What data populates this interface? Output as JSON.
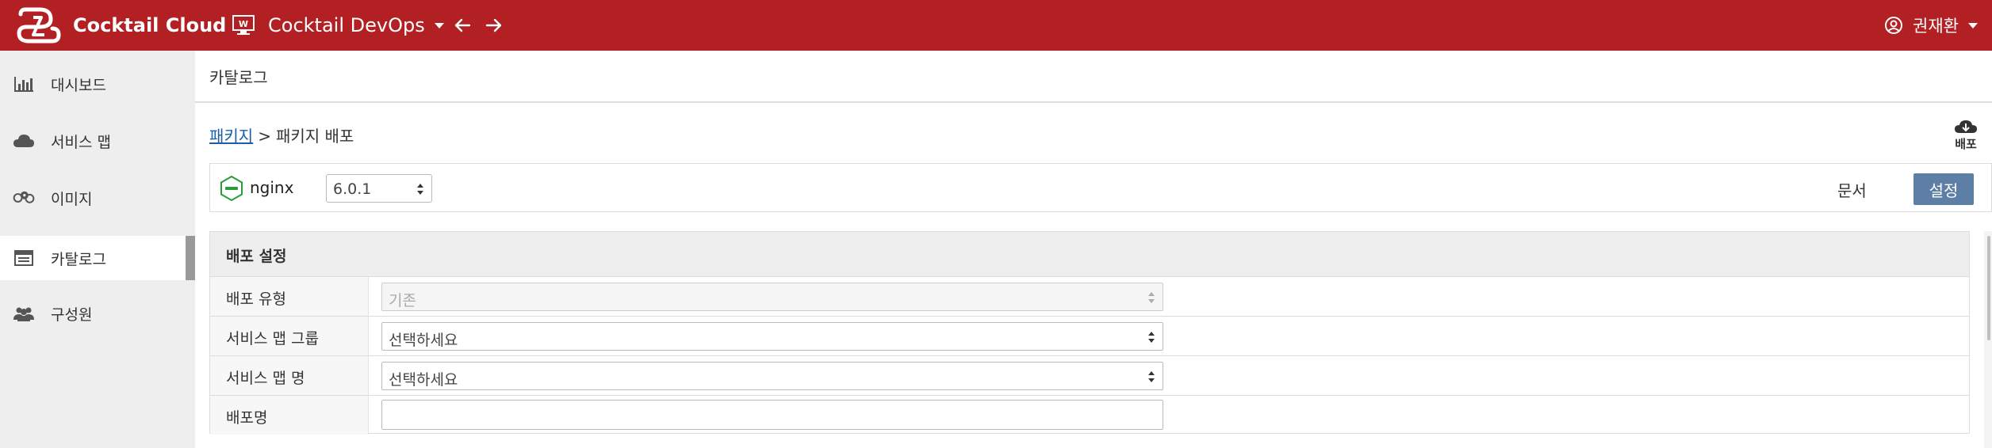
{
  "header": {
    "brand_name": "Cocktail Cloud",
    "workspace_name": "Cocktail DevOps",
    "user_name": "권재환",
    "colors": {
      "bar": "#b32024",
      "text": "#ffffff"
    },
    "icons": [
      "cocktail-logo",
      "workspace-icon",
      "arrow-left-icon",
      "arrow-right-icon",
      "user-icon",
      "chevron-down-icon"
    ]
  },
  "sidebar": {
    "items": [
      {
        "label": "대시보드",
        "icon": "bar-chart-icon",
        "active": false
      },
      {
        "label": "서비스 맵",
        "icon": "cloud-icon",
        "active": false
      },
      {
        "label": "이미지",
        "icon": "cubes-icon",
        "active": false
      },
      {
        "label": "카탈로그",
        "icon": "list-icon",
        "active": true
      },
      {
        "label": "구성원",
        "icon": "users-icon",
        "active": false
      }
    ]
  },
  "page": {
    "title": "카탈로그",
    "breadcrumb": {
      "link": "패키지",
      "separator": ">",
      "current": "패키지 배포"
    },
    "deploy_label": "배포",
    "package": {
      "name": "nginx",
      "version": "6.0.1",
      "docs_label": "문서",
      "settings_label": "설정",
      "settings_color": "#5d7fa6"
    },
    "panel": {
      "title": "배포 설정",
      "rows": [
        {
          "label": "배포 유형",
          "value": "기존",
          "disabled": true
        },
        {
          "label": "서비스 맵 그룹",
          "value": "선택하세요",
          "disabled": false
        },
        {
          "label": "서비스 맵 명",
          "value": "선택하세요",
          "disabled": false
        },
        {
          "label": "배포명",
          "value": ""
        }
      ]
    }
  }
}
